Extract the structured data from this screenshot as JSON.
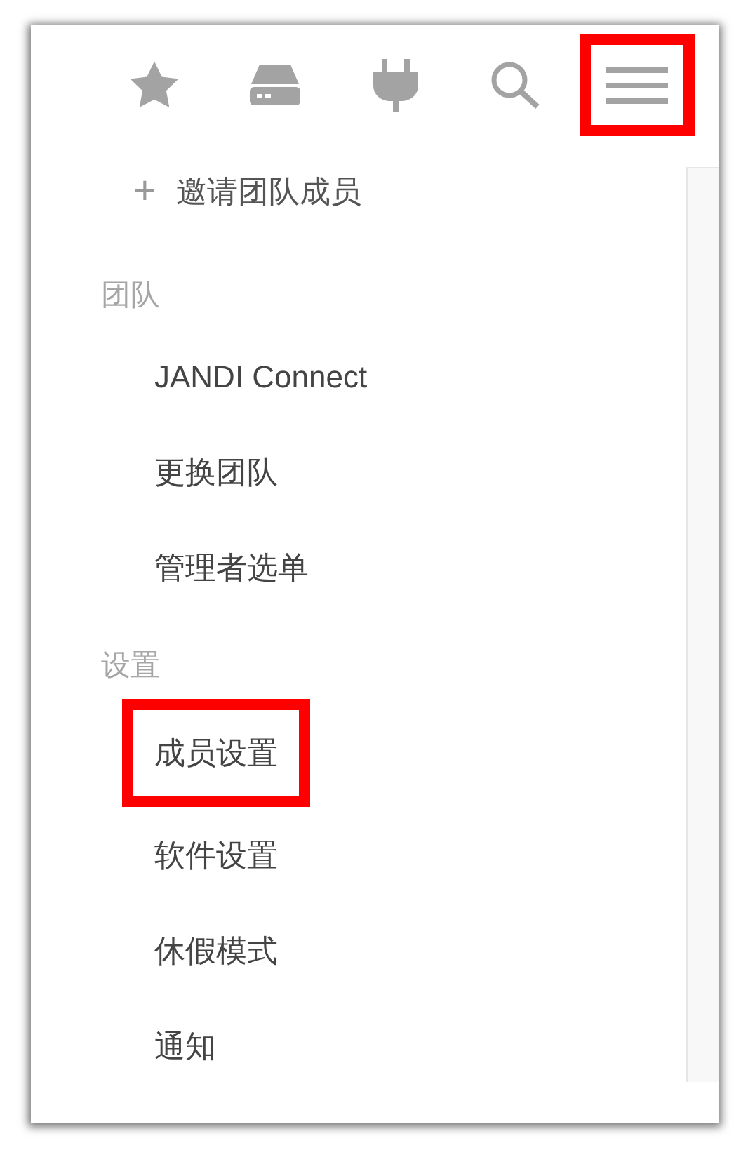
{
  "toolbar": [
    {
      "kind": "star",
      "highlighted": false
    },
    {
      "kind": "drive",
      "highlighted": false
    },
    {
      "kind": "plug",
      "highlighted": false
    },
    {
      "kind": "search",
      "highlighted": false
    },
    {
      "kind": "menu",
      "highlighted": true
    }
  ],
  "invite": {
    "icon": "+",
    "label": "邀请团队成员"
  },
  "sections": [
    {
      "title": "团队",
      "items": [
        {
          "label": "JANDI Connect",
          "highlighted": false
        },
        {
          "label": "更换团队",
          "highlighted": false
        },
        {
          "label": "管理者选单",
          "highlighted": false
        }
      ]
    },
    {
      "title": "设置",
      "items": [
        {
          "label": "成员设置",
          "highlighted": true
        },
        {
          "label": "软件设置",
          "highlighted": false
        },
        {
          "label": "休假模式",
          "highlighted": false
        },
        {
          "label": "通知",
          "highlighted": false
        }
      ]
    }
  ]
}
